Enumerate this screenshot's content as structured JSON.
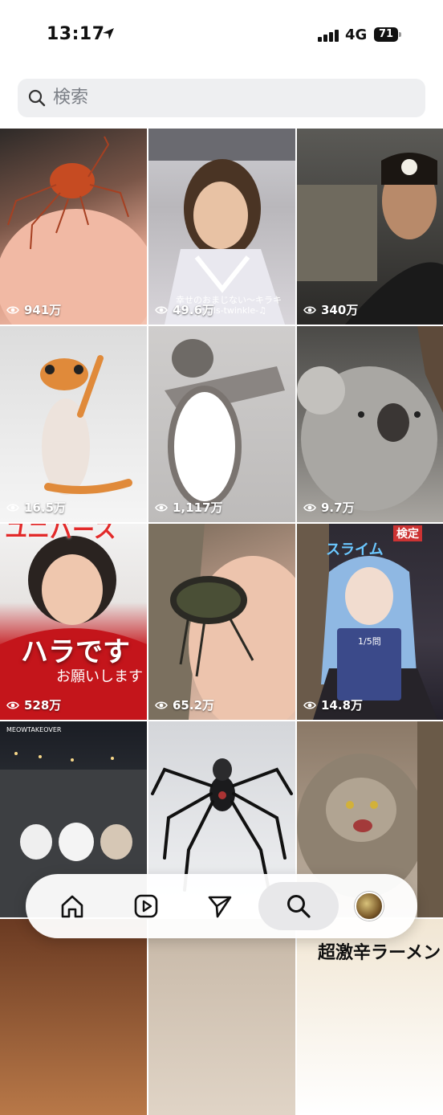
{
  "status": {
    "time": "13:17",
    "network": "4G",
    "battery": "71"
  },
  "search": {
    "placeholder": "検索"
  },
  "tiles": [
    {
      "views": "941万",
      "icon": "eye-icon"
    },
    {
      "views": "49.6万",
      "caption1": "幸せのおまじない〜キラキラ〜♫",
      "caption2": "bells-twinkle-♫"
    },
    {
      "views": "340万"
    },
    {
      "views": "16.5万"
    },
    {
      "views": "1,117万"
    },
    {
      "views": "9.7万"
    },
    {
      "views": "528万",
      "overlay_title": "ハラです",
      "overlay_sub": "お願いします",
      "overlay_top": "ユニバース"
    },
    {
      "views": "65.2万"
    },
    {
      "views": "14.8万",
      "overlay_top": "スライム",
      "overlay_badge": "検定",
      "overlay_small": "1/5問"
    },
    {
      "views": "",
      "overlay_top": "MEOWTAKEOVER"
    },
    {
      "views": ""
    },
    {
      "views": ""
    },
    {
      "views": ""
    },
    {
      "views": ""
    },
    {
      "views": "",
      "overlay_title": "超激辛ラーメン"
    }
  ],
  "tabbar": {
    "items": [
      "home-icon",
      "reels-icon",
      "send-icon",
      "search-icon",
      "profile-avatar"
    ],
    "active": "search-icon"
  }
}
